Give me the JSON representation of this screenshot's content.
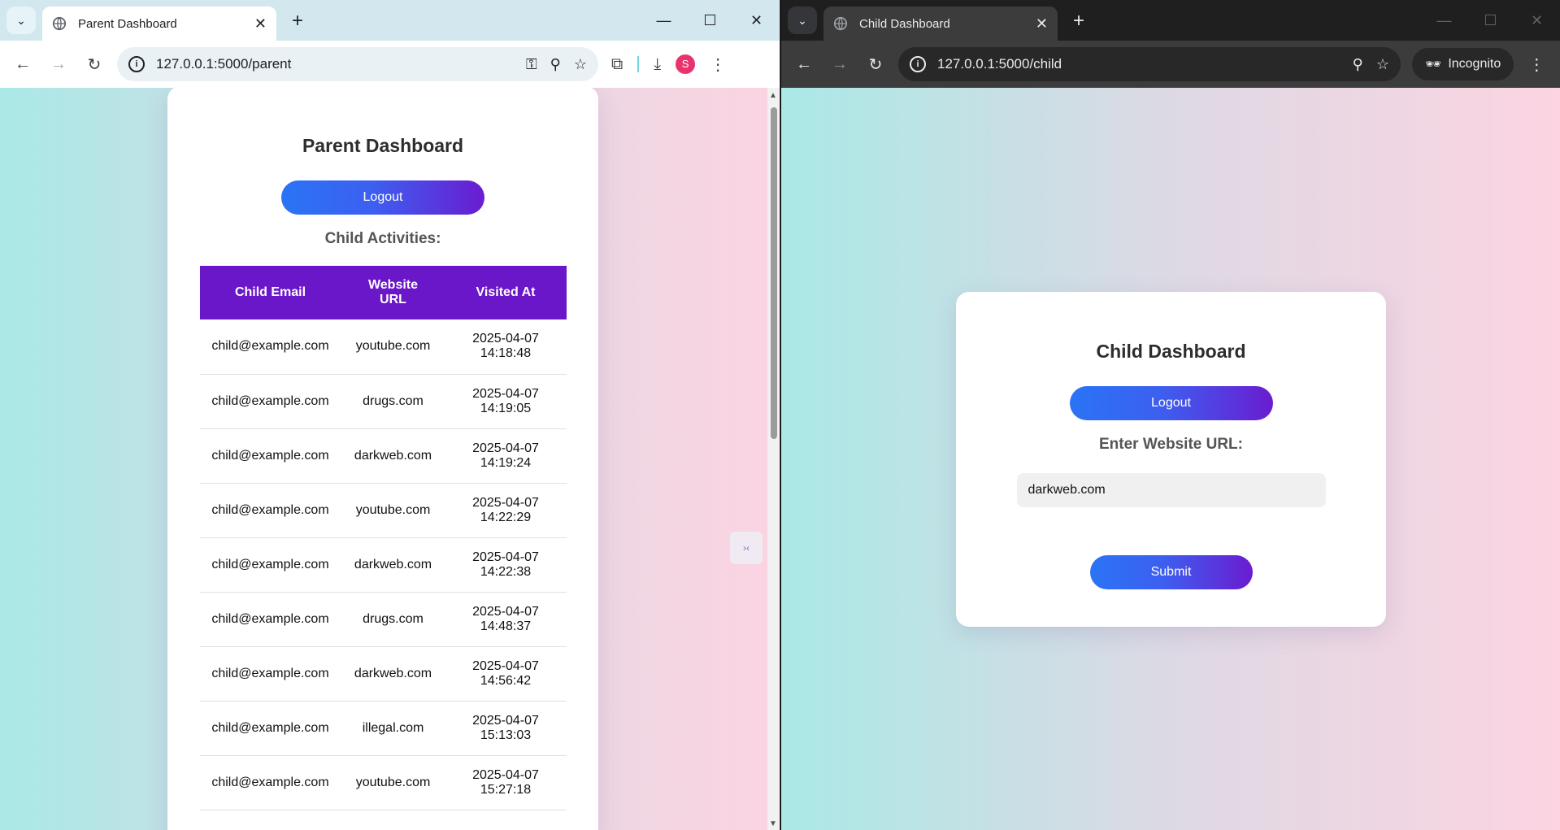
{
  "left": {
    "tab_title": "Parent Dashboard",
    "url": "127.0.0.1:5000/parent",
    "avatar_letter": "S",
    "page": {
      "title": "Parent Dashboard",
      "logout": "Logout",
      "subheading": "Child Activities:",
      "columns": [
        "Child Email",
        "Website URL",
        "Visited At"
      ],
      "rows": [
        {
          "email": "child@example.com",
          "url": "youtube.com",
          "date": "2025-04-07",
          "time": "14:18:48"
        },
        {
          "email": "child@example.com",
          "url": "drugs.com",
          "date": "2025-04-07",
          "time": "14:19:05"
        },
        {
          "email": "child@example.com",
          "url": "darkweb.com",
          "date": "2025-04-07",
          "time": "14:19:24"
        },
        {
          "email": "child@example.com",
          "url": "youtube.com",
          "date": "2025-04-07",
          "time": "14:22:29"
        },
        {
          "email": "child@example.com",
          "url": "darkweb.com",
          "date": "2025-04-07",
          "time": "14:22:38"
        },
        {
          "email": "child@example.com",
          "url": "drugs.com",
          "date": "2025-04-07",
          "time": "14:48:37"
        },
        {
          "email": "child@example.com",
          "url": "darkweb.com",
          "date": "2025-04-07",
          "time": "14:56:42"
        },
        {
          "email": "child@example.com",
          "url": "illegal.com",
          "date": "2025-04-07",
          "time": "15:13:03"
        },
        {
          "email": "child@example.com",
          "url": "youtube.com",
          "date": "2025-04-07",
          "time": "15:27:18"
        }
      ]
    }
  },
  "right": {
    "tab_title": "Child Dashboard",
    "url": "127.0.0.1:5000/child",
    "incognito_label": "Incognito",
    "page": {
      "title": "Child Dashboard",
      "logout": "Logout",
      "label": "Enter Website URL:",
      "input_value": "darkweb.com",
      "submit": "Submit"
    }
  },
  "colors": {
    "header_purple": "#6a16c9",
    "btn_gradient_start": "#2a74f5",
    "btn_gradient_end": "#6a1cd0"
  }
}
